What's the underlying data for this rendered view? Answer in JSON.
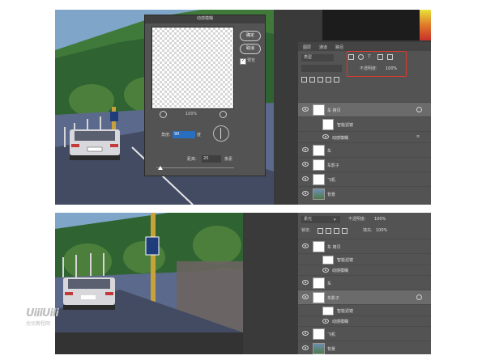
{
  "dialog": {
    "title": "动感模糊",
    "ok_label": "确定",
    "cancel_label": "取消",
    "preview_label": "预览",
    "zoom_value": "100%",
    "angle_label": "角度:",
    "angle_value": "90",
    "angle_unit": "度",
    "distance_label": "距离:",
    "distance_value": "20",
    "distance_unit": "像素"
  },
  "panel_top": {
    "tabs": [
      "图层",
      "通道",
      "路径"
    ],
    "search_placeholder": "类型",
    "opacity_label": "不透明度:",
    "opacity_value": "100%",
    "layers": [
      {
        "name": "车 拷贝",
        "type": "smart"
      },
      {
        "name": "智能滤镜",
        "type": "filter"
      },
      {
        "name": "动感模糊",
        "type": "filter-item"
      },
      {
        "name": "车",
        "type": "smart"
      },
      {
        "name": "车影子",
        "type": "smart"
      },
      {
        "name": "飞机",
        "type": "smart"
      },
      {
        "name": "背景",
        "type": "image"
      }
    ]
  },
  "panel_bottom": {
    "blend_mode": "柔光",
    "opacity_label": "不透明度:",
    "opacity_value": "100%",
    "lock_label": "锁定:",
    "fill_label": "填充:",
    "fill_value": "100%",
    "layers": [
      {
        "name": "车 拷贝",
        "type": "smart"
      },
      {
        "name": "智能滤镜",
        "type": "filter"
      },
      {
        "name": "动感模糊",
        "type": "filter-item"
      },
      {
        "name": "车",
        "type": "smart"
      },
      {
        "name": "车影子",
        "type": "smart"
      },
      {
        "name": "智能滤镜",
        "type": "filter"
      },
      {
        "name": "动感模糊",
        "type": "filter-item"
      },
      {
        "name": "飞机",
        "type": "smart"
      },
      {
        "name": "背景",
        "type": "image"
      }
    ]
  },
  "watermark": {
    "logo": "UiiiUiii",
    "caption": "优优教程网"
  },
  "colors": {
    "highlight_box": "#e03a2a",
    "ps_panel": "#535353",
    "ps_bg": "#3a3a3a"
  }
}
